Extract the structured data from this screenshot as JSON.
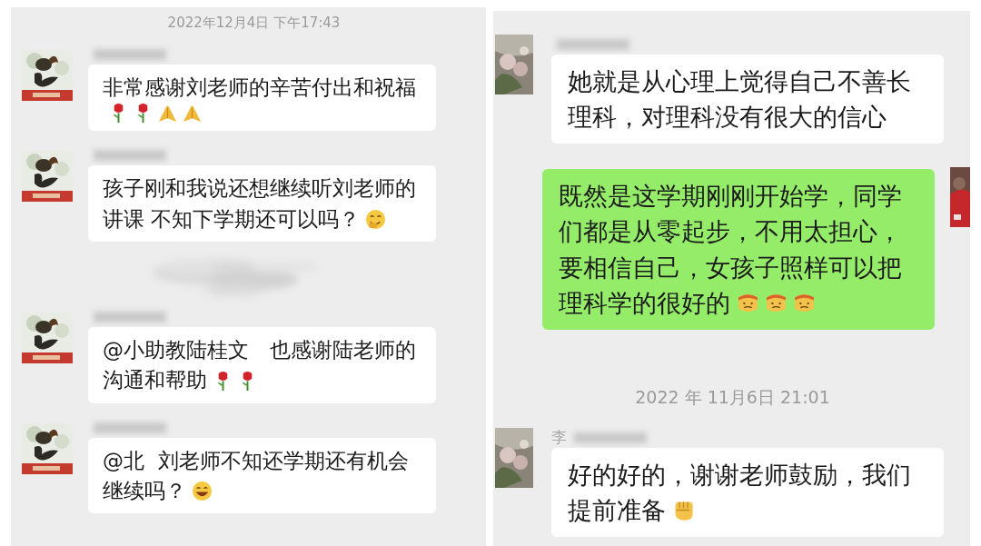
{
  "panels": [
    {
      "items": [
        {
          "kind": "timestamp",
          "text": "2022年12月4日 下午17:43"
        },
        {
          "kind": "incoming",
          "avatar": {
            "kind": "rooster"
          },
          "lines": [
            "非常感谢刘老师的辛苦付出和祝福"
          ],
          "emojis": [
            {
              "kind": "rose"
            },
            {
              "kind": "rose"
            },
            {
              "kind": "pray"
            },
            {
              "kind": "pray"
            }
          ]
        },
        {
          "kind": "incoming",
          "avatar": {
            "kind": "rooster"
          },
          "lines": [
            "孩子刚和我说还想继续听刘老师的",
            "讲课 不知下学期还可以吗？"
          ],
          "emojis": [
            {
              "kind": "smirk"
            }
          ]
        },
        {
          "kind": "smudge"
        },
        {
          "kind": "incoming",
          "avatar": {
            "kind": "rooster"
          },
          "lines": [
            "@小助教陆桂文　也感谢陆老师的",
            "沟通和帮助"
          ],
          "emojis": [
            {
              "kind": "rose"
            },
            {
              "kind": "rose"
            }
          ]
        },
        {
          "kind": "incoming",
          "avatar": {
            "kind": "rooster"
          },
          "lines": [
            "@北  刘老师不知还学期还有机会",
            "继续吗？"
          ],
          "emojis": [
            {
              "kind": "grin"
            }
          ]
        }
      ]
    },
    {
      "items": [
        {
          "kind": "incoming",
          "avatar": {
            "kind": "flowers"
          },
          "lines": [
            "她就是从心理上觉得自己不善长",
            "理科，对理科没有很大的信心"
          ]
        },
        {
          "kind": "outgoing",
          "avatar": {
            "kind": "red"
          },
          "lines": [
            "既然是这学期刚刚开始学，同学",
            "们都是从零起步，不用太担心，",
            "要相信自己，女孩子照样可以把",
            "理科学的很好的"
          ],
          "emojis": [
            {
              "kind": "facepalm"
            },
            {
              "kind": "facepalm"
            },
            {
              "kind": "facepalm"
            }
          ]
        },
        {
          "kind": "timestamp",
          "text": "2022 年 11月6日 21:01"
        },
        {
          "kind": "incoming",
          "avatar": {
            "kind": "flowers"
          },
          "sender": "李",
          "lines": [
            "好的好的，谢谢老师鼓励，我们",
            "提前准备"
          ],
          "emojis": [
            {
              "kind": "fist"
            }
          ]
        }
      ]
    }
  ]
}
